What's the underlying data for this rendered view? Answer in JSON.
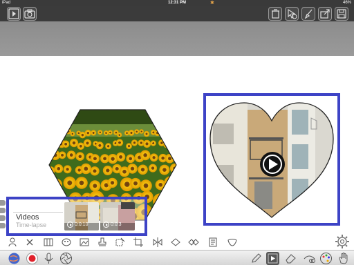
{
  "status_bar": {
    "device": "iPad",
    "time": "12:31 PM",
    "battery": "46%"
  },
  "top_toolbar": {
    "left_icons": [
      "play-square-icon",
      "camera-icon"
    ],
    "right_icons": [
      "trash-icon",
      "move-select-icon",
      "brush-icon",
      "share-icon",
      "save-icon"
    ]
  },
  "canvas": {
    "hexagon_image": "sunflower-field",
    "heart_video": "building-video",
    "colors": {
      "selection_border": "#3d43c6",
      "toolbar_bg": "#3b3b3b",
      "grey_band": "#939393"
    }
  },
  "videos_panel": {
    "title": "Videos",
    "subtitle": "Time-lapse",
    "clips": [
      {
        "duration": "0:0:10"
      },
      {
        "duration": "0:0:3"
      }
    ]
  },
  "shape_toolbar": {
    "icons": [
      "person-icon",
      "x-icon",
      "grid-icon",
      "theater-mask-icon",
      "image-icon",
      "stamp-icon",
      "select-area-icon",
      "crop-icon",
      "flip-icon",
      "diamond-icon",
      "diamonds-icon",
      "page-icon",
      "mask-icon",
      "gear-icon"
    ]
  },
  "bottom_bar": {
    "icons": [
      "globe-icon",
      "record-icon",
      "microphone-icon",
      "aperture-icon",
      "pencil-icon",
      "play-icon",
      "eraser-icon",
      "scissors-path-icon",
      "palette-icon",
      "hand-icon"
    ]
  }
}
